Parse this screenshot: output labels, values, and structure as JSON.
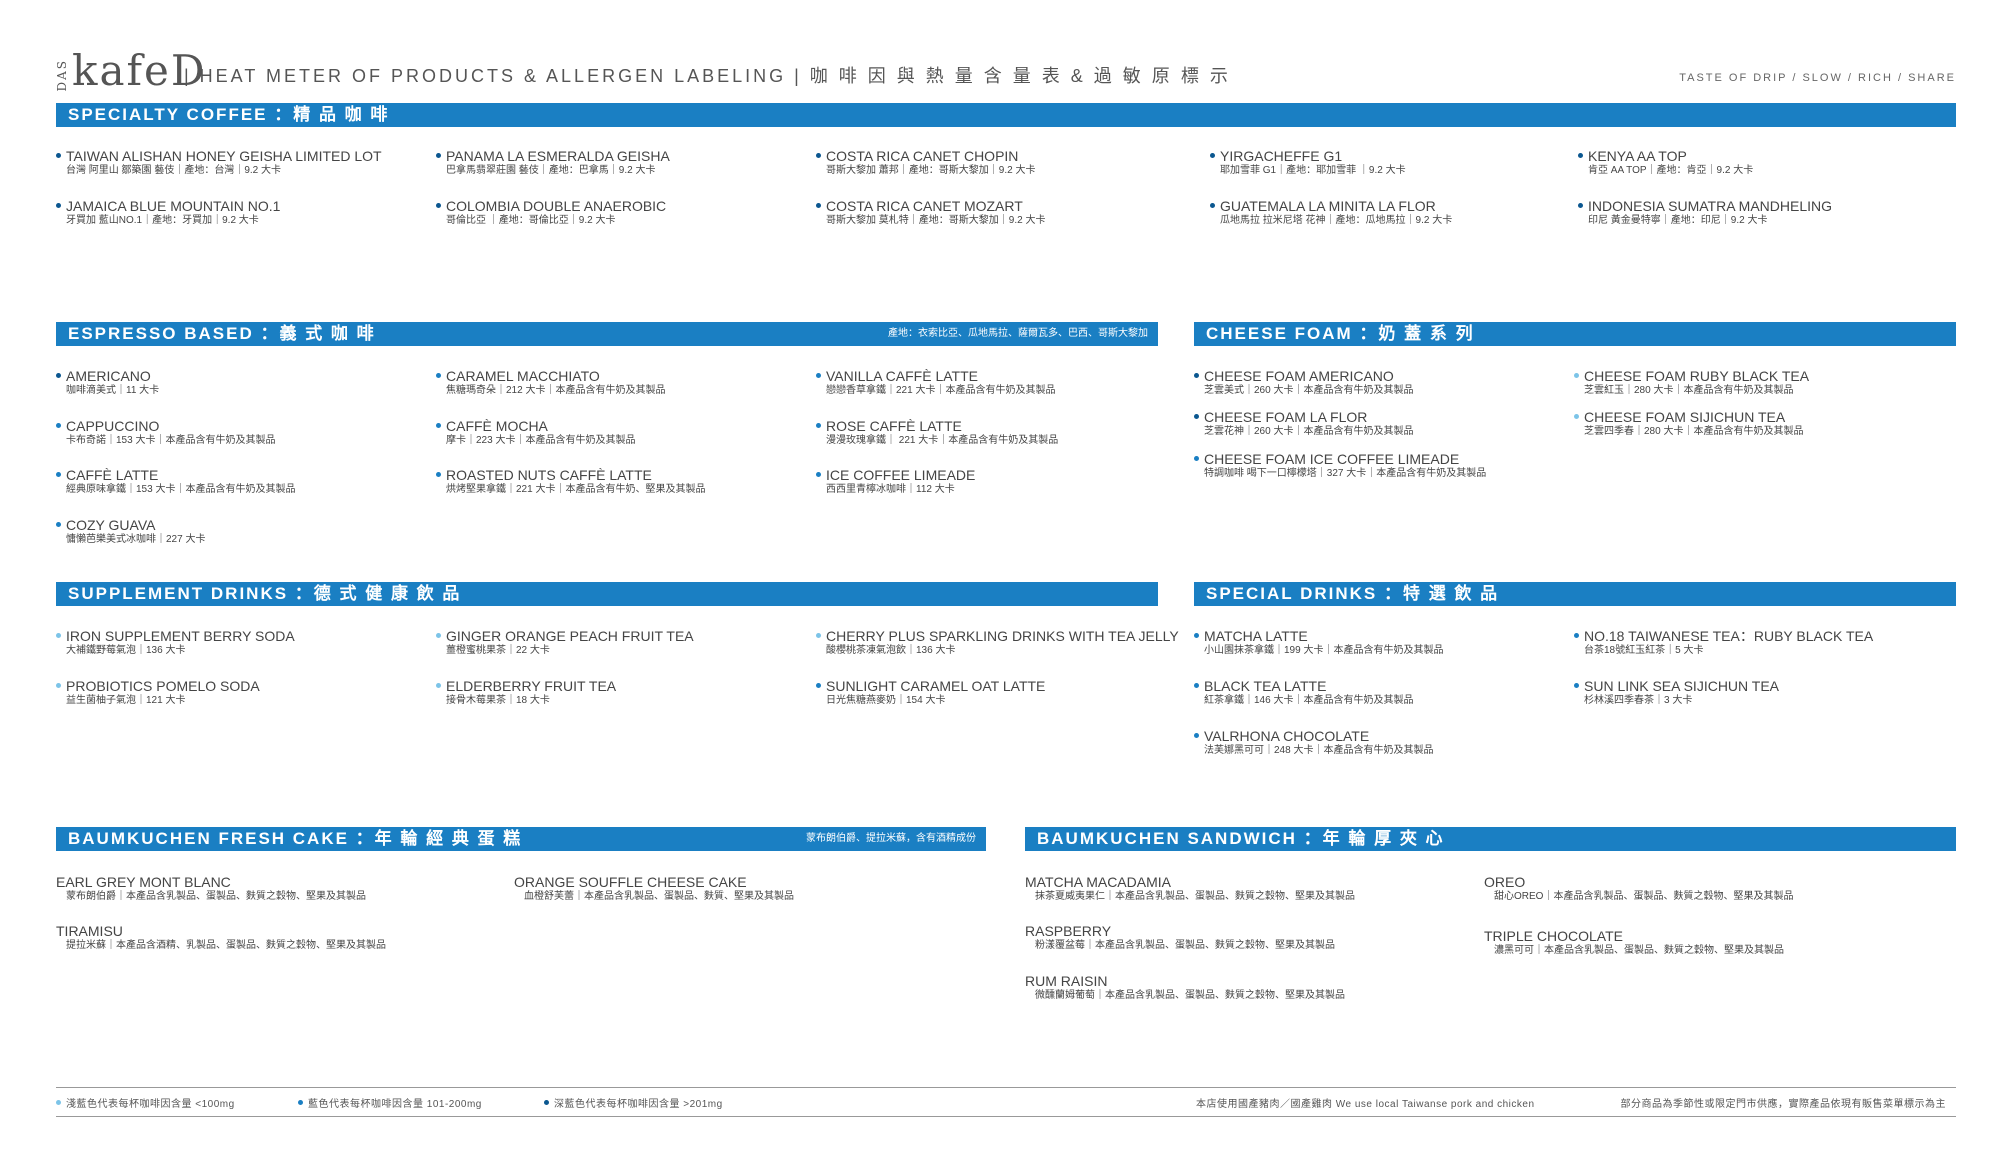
{
  "header": {
    "brand_das": "DAS",
    "brand_name": "kafeD",
    "title": "|  HEAT  METER  OF  PRODUCTS  &  ALLERGEN  LABELING  |   咖 啡 因 與 熱 量 含 量 表   &   過 敏 原 標 示",
    "tagline": "TASTE OF DRIP / SLOW / RICH / SHARE"
  },
  "sections": {
    "specialty": {
      "title": "SPECIALTY  COFFEE ：精 品 咖 啡"
    },
    "espresso": {
      "title": "ESPRESSO BASED ：義 式 咖 啡",
      "note": "產地：衣索比亞、瓜地馬拉、薩爾瓦多、巴西、哥斯大黎加"
    },
    "cheese": {
      "title": "CHEESE FOAM ：奶 蓋 系 列"
    },
    "supplement": {
      "title": "SUPPLEMENT DRINKS ：德 式 健 康 飲 品"
    },
    "special": {
      "title": "SPECIAL DRINKS ：特 選 飲 品"
    },
    "cake": {
      "title": "BAUMKUCHEN FRESH CAKE ：年 輪 經 典 蛋 糕",
      "note": "蒙布朗伯爵、提拉米蘇，含有酒精成份"
    },
    "sandwich": {
      "title": "BAUMKUCHEN SANDWICH ：年 輪 厚 夾 心"
    }
  },
  "items": {
    "sp1": {
      "title": "TAIWAN ALISHAN  HONEY GEISHA  LIMITED LOT",
      "sub": "台灣 阿里山 鄒築園 藝伎｜產地：台灣｜9.2 大卡",
      "dot": "c3"
    },
    "sp2": {
      "title": "PANAMA  LA  ESMERALDA  GEISHA",
      "sub": "巴拿馬翡翠莊園 藝伎｜產地：巴拿馬｜9.2 大卡",
      "dot": "c3"
    },
    "sp3": {
      "title": "COSTA  RICA  CANET  CHOPIN",
      "sub": "哥斯大黎加 蕭邦｜產地：哥斯大黎加｜9.2 大卡",
      "dot": "c3"
    },
    "sp4": {
      "title": "YIRGACHEFFE    G1",
      "sub": "耶加雪菲  G1｜產地：耶加雪菲 ｜9.2 大卡",
      "dot": "c3"
    },
    "sp5": {
      "title": "KENYA  AA  TOP",
      "sub": "肯亞 AA TOP｜產地：肯亞｜9.2 大卡",
      "dot": "c3"
    },
    "sp6": {
      "title": "JAMAICA  BLUE  MOUNTAIN  NO.1",
      "sub": "牙買加 藍山NO.1｜產地：牙買加｜9.2 大卡",
      "dot": "c3"
    },
    "sp7": {
      "title": "COLOMBIA  DOUBLE  ANAEROBIC",
      "sub": "哥倫比亞 ｜產地：哥倫比亞｜9.2 大卡",
      "dot": "c3"
    },
    "sp8": {
      "title": "COSTA  RICA  CANET  MOZART",
      "sub": "哥斯大黎加 莫札特｜產地：哥斯大黎加｜9.2 大卡",
      "dot": "c3"
    },
    "sp9": {
      "title": "GUATEMALA  LA  MINITA  LA  FLOR",
      "sub": "瓜地馬拉 拉米尼塔 花神｜產地：瓜地馬拉｜9.2 大卡",
      "dot": "c3"
    },
    "sp10": {
      "title": "INDONESIA  SUMATRA  MANDHELING",
      "sub": "印尼 黃金曼特寧｜產地：印尼｜9.2 大卡",
      "dot": "c3"
    },
    "es1": {
      "title": "AMERICANO",
      "sub": "咖啡滴美式｜11 大卡",
      "dot": "c3"
    },
    "es2": {
      "title": "CARAMEL  MACCHIATO",
      "sub": "焦糖瑪奇朵｜212 大卡｜本產品含有牛奶及其製品",
      "dot": "c2"
    },
    "es3": {
      "title": "VANILLA  CAFFÈ  LATTE",
      "sub": "戀戀香草拿鐵｜221 大卡｜本產品含有牛奶及其製品",
      "dot": "c2"
    },
    "es4": {
      "title": "CAPPUCCINO",
      "sub": "卡布奇諾｜153 大卡｜本產品含有牛奶及其製品",
      "dot": "c2"
    },
    "es5": {
      "title": "CAFFÈ  MOCHA",
      "sub": "摩卡｜223 大卡｜本產品含有牛奶及其製品",
      "dot": "c2"
    },
    "es6": {
      "title": "ROSE  CAFFÈ  LATTE",
      "sub": "漫漫玫瑰拿鐵｜ 221 大卡｜本產品含有牛奶及其製品",
      "dot": "c2"
    },
    "es7": {
      "title": "CAFFÈ  LATTE",
      "sub": "經典原味拿鐵｜153 大卡｜本產品含有牛奶及其製品",
      "dot": "c2"
    },
    "es8": {
      "title": "ROASTED NUTS CAFFÈ LATTE",
      "sub": "烘烤堅果拿鐵｜221 大卡｜本產品含有牛奶、堅果及其製品",
      "dot": "c2"
    },
    "es9": {
      "title": "ICE COFFEE LIMEADE",
      "sub": "西西里青檸冰咖啡｜112 大卡",
      "dot": "c2"
    },
    "es10": {
      "title": "COZY GUAVA",
      "sub": "慵懶芭樂美式冰咖啡｜227 大卡",
      "dot": "c2"
    },
    "ch1": {
      "title": "CHEESE FOAM AMERICANO",
      "sub": "芝雲美式｜260 大卡｜本產品含有牛奶及其製品",
      "dot": "c3"
    },
    "ch2": {
      "title": "CHEESE FOAM RUBY BLACK TEA",
      "sub": "芝雲紅玉｜280 大卡｜本產品含有牛奶及其製品",
      "dot": "c1"
    },
    "ch3": {
      "title": "CHEESE FOAM LA FLOR",
      "sub": "芝雲花神｜260 大卡｜本產品含有牛奶及其製品",
      "dot": "c3"
    },
    "ch4": {
      "title": "CHEESE FOAM SIJICHUN TEA",
      "sub": "芝雲四季春｜280 大卡｜本產品含有牛奶及其製品",
      "dot": "c1"
    },
    "ch5": {
      "title": "CHEESE FOAM ICE COFFEE LIMEADE",
      "sub": "特調咖啡 喝下一口檸檬塔｜327 大卡｜本產品含有牛奶及其製品",
      "dot": "c2"
    },
    "su1": {
      "title": "IRON SUPPLEMENT BERRY SODA",
      "sub": "大補鐵野莓氣泡｜136 大卡",
      "dot": "c1"
    },
    "su2": {
      "title": "GINGER ORANGE PEACH FRUIT TEA",
      "sub": "薑橙蜜桃果茶｜22 大卡",
      "dot": "c1"
    },
    "su3": {
      "title": "CHERRY PLUS SPARKLING DRINKS WITH TEA JELLY",
      "sub": "酸櫻桃茶凍氣泡飲｜136 大卡",
      "dot": "c1"
    },
    "su4": {
      "title": "PROBIOTICS POMELO SODA",
      "sub": "益生菌柚子氣泡｜121 大卡",
      "dot": "c1"
    },
    "su5": {
      "title": "ELDERBERRY FRUIT TEA",
      "sub": "接骨木莓果茶｜18 大卡",
      "dot": "c1"
    },
    "su6": {
      "title": "SUNLIGHT CARAMEL OAT LATTE",
      "sub": "日光焦糖燕麥奶｜154 大卡",
      "dot": "c2"
    },
    "sd1": {
      "title": "MATCHA  LATTE",
      "sub": "小山園抹茶拿鐵｜199 大卡｜本產品含有牛奶及其製品",
      "dot": "c2"
    },
    "sd2": {
      "title": "NO.18 TAIWANESE TEA：RUBY BLACK TEA",
      "sub": "台茶18號紅玉紅茶｜5 大卡",
      "dot": "c2"
    },
    "sd3": {
      "title": "BLACK TEA  LATTE",
      "sub": "紅茶拿鐵｜146 大卡｜本產品含有牛奶及其製品",
      "dot": "c2"
    },
    "sd4": {
      "title": "SUN LINK SEA SIJICHUN TEA",
      "sub": "杉林溪四季春茶｜3 大卡",
      "dot": "c2"
    },
    "sd5": {
      "title": "VALRHONA CHOCOLATE",
      "sub": "法芙娜黑可可｜248 大卡｜本產品含有牛奶及其製品",
      "dot": "c2"
    },
    "ck1": {
      "title": "EARL  GREY  MONT  BLANC",
      "sub": "蒙布朗伯爵｜本產品含乳製品、蛋製品、麩質之穀物、堅果及其製品"
    },
    "ck2": {
      "title": "ORANGE SOUFFLE CHEESE CAKE",
      "sub": "血橙舒芙蕾｜本產品含乳製品、蛋製品、麩質、堅果及其製品"
    },
    "ck3": {
      "title": "TIRAMISU",
      "sub": "提拉米蘇｜本產品含酒精、乳製品、蛋製品、麩質之穀物、堅果及其製品"
    },
    "sw1": {
      "title": "MATCHA  MACADAMIA",
      "sub": "抹茶夏威夷果仁｜本產品含乳製品、蛋製品、麩質之穀物、堅果及其製品"
    },
    "sw2": {
      "title": "OREO",
      "sub": "甜心OREO｜本產品含乳製品、蛋製品、麩質之穀物、堅果及其製品"
    },
    "sw3": {
      "title": "RASPBERRY",
      "sub": "粉漾覆盆莓｜本產品含乳製品、蛋製品、麩質之穀物、堅果及其製品"
    },
    "sw4": {
      "title": "TRIPLE  CHOCOLATE",
      "sub": "濃黑可可｜本產品含乳製品、蛋製品、麩質之穀物、堅果及其製品"
    },
    "sw5": {
      "title": "RUM  RAISIN",
      "sub": "微醺蘭姆葡萄｜本產品含乳製品、蛋製品、麩質之穀物、堅果及其製品"
    }
  },
  "footer": {
    "legend1": "淺藍色代表每杯咖啡因含量 <100mg",
    "legend2": "藍色代表每杯咖啡因含量 101-200mg",
    "legend3": "深藍色代表每杯咖啡因含量 >201mg",
    "pork": "本店使用國產豬肉／國產雞肉  We use local Taiwanse pork and chicken",
    "notice": "部分商品為季節性或限定門市供應，實際產品依現有販售菜單標示為主"
  },
  "colors": {
    "accent": "#1a7fc3",
    "light": "#7cc4e8",
    "dark": "#0b5790"
  }
}
